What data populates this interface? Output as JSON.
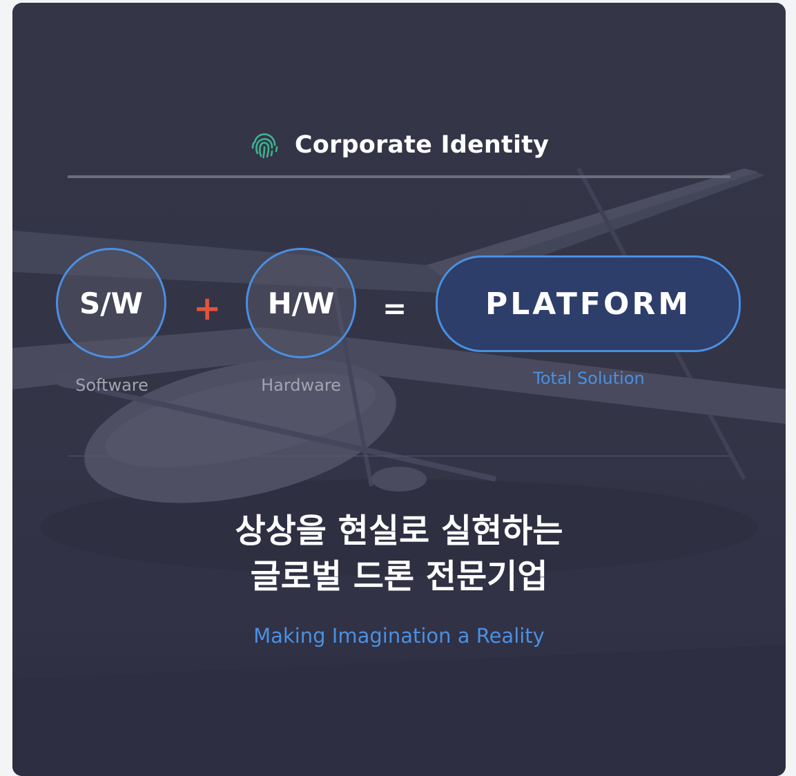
{
  "header": {
    "icon": "fingerprint-icon",
    "title": "Corporate Identity"
  },
  "equation": {
    "sw": {
      "label": "S/W",
      "caption": "Software"
    },
    "plus": "+",
    "hw": {
      "label": "H/W",
      "caption": "Hardware"
    },
    "equals": "=",
    "result": {
      "label": "PLATFORM",
      "caption": "Total Solution"
    }
  },
  "headline": {
    "line1": "상상을 현실로 실현하는",
    "line2": "글로벌 드론 전문기업"
  },
  "tagline": "Making Imagination a Reality",
  "colors": {
    "accent": "#4a90e2",
    "plus": "#e0553a",
    "icon": "#3bb58f",
    "card_bg": "#3b3c4d",
    "platform_bg": "#2d3e6a"
  },
  "background": "drone-photo-image"
}
